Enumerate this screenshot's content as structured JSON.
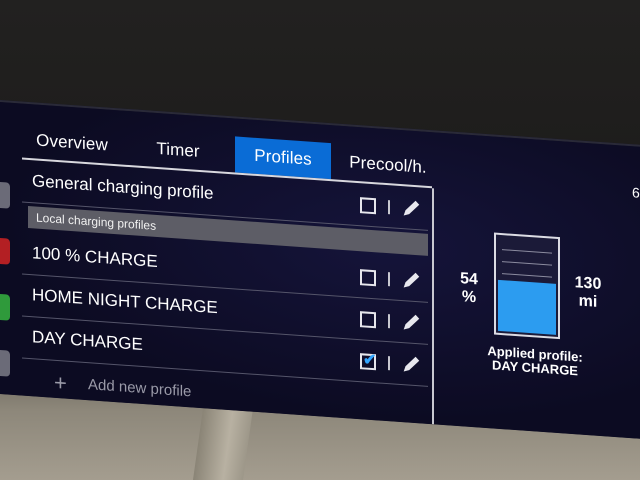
{
  "tabs": [
    {
      "label": "Overview",
      "active": false
    },
    {
      "label": "Timer",
      "active": false
    },
    {
      "label": "Profiles",
      "active": true
    },
    {
      "label": "Precool/h.",
      "active": false
    }
  ],
  "general_profile": {
    "label": "General charging profile",
    "checked": false
  },
  "section_header": "Local charging profiles",
  "profiles": [
    {
      "label": "100 % CHARGE",
      "checked": false
    },
    {
      "label": "HOME NIGHT CHARGE",
      "checked": false
    },
    {
      "label": "DAY CHARGE",
      "checked": true
    }
  ],
  "add_profile": {
    "label": "Add new profile",
    "icon": "plus-icon"
  },
  "battery": {
    "percent_value": "54",
    "percent_unit": "%",
    "range_value": "130",
    "range_unit": "mi",
    "fill_fraction": 0.54
  },
  "applied": {
    "label": "Applied profile:",
    "value": "DAY CHARGE"
  },
  "status": {
    "digit": "6"
  },
  "colors": {
    "accent": "#0a6cd6",
    "battery_fill": "#2c9cf0",
    "checkmark": "#33a6ff"
  }
}
